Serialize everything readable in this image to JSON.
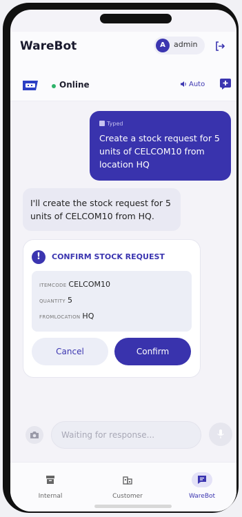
{
  "header": {
    "title": "WareBot",
    "user_initial": "A",
    "user_name": "admin"
  },
  "status": {
    "state": "Online",
    "auto_label": "Auto"
  },
  "messages": {
    "user": {
      "badge": "Typed",
      "text": "Create a stock request for 5 units of CELCOM10 from location HQ"
    },
    "bot": {
      "text": "I'll create the stock request for 5 units of CELCOM10 from HQ."
    }
  },
  "confirm": {
    "title": "CONFIRM STOCK REQUEST",
    "fields": [
      {
        "key": "ITEMCODE",
        "value": "CELCOM10"
      },
      {
        "key": "QUANTITY",
        "value": "5"
      },
      {
        "key": "FROMLOCATION",
        "value": "HQ"
      }
    ],
    "cancel_label": "Cancel",
    "confirm_label": "Confirm"
  },
  "composer": {
    "placeholder": "Waiting for response..."
  },
  "tabs": [
    {
      "label": "Internal",
      "icon": "archive-icon"
    },
    {
      "label": "Customer",
      "icon": "building-icon"
    },
    {
      "label": "WareBot",
      "icon": "chat-icon"
    }
  ],
  "colors": {
    "accent": "#3933ad",
    "online": "#2fb36a"
  }
}
